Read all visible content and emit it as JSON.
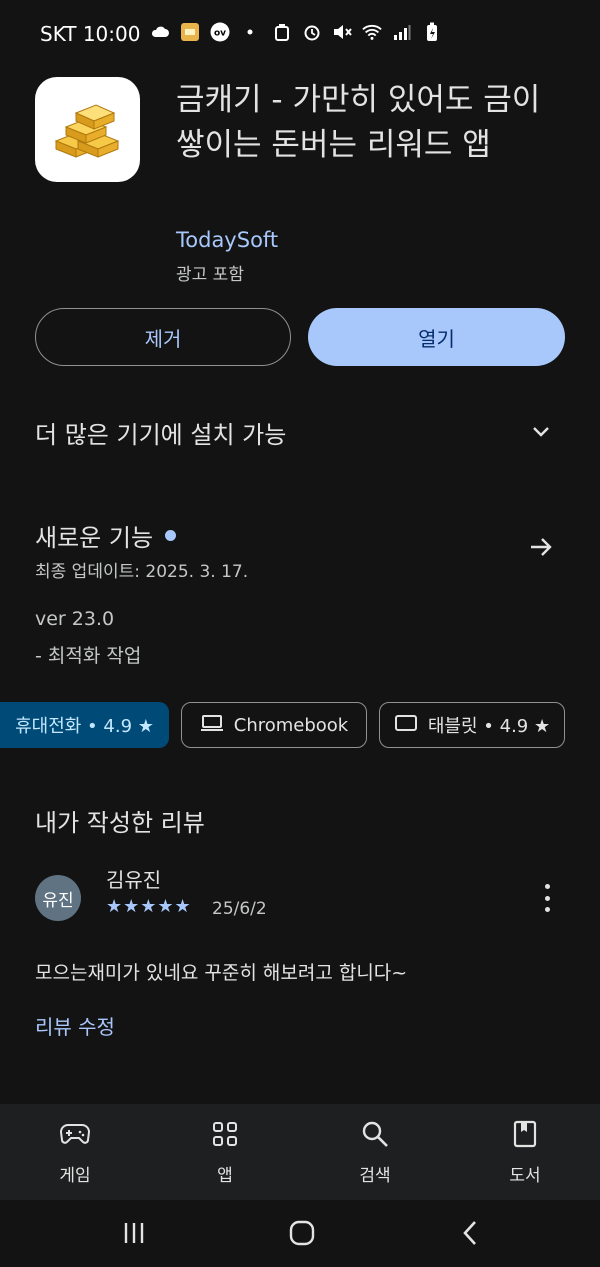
{
  "status_bar": {
    "carrier_time": "SKT 10:00",
    "icons": [
      "cloud-icon",
      "notification-app-icon",
      "ov-badge-icon",
      "dot-icon",
      "lock-battery-icon",
      "alarm-icon",
      "mute-icon",
      "wifi-icon",
      "signal-icon",
      "battery-charging-icon"
    ]
  },
  "app": {
    "title": "금캐기 - 가만히 있어도 금이 쌓이는 돈버는 리워드 앱",
    "developer": "TodaySoft",
    "ad_label": "광고 포함",
    "icon": "gold-bars-icon"
  },
  "buttons": {
    "remove": "제거",
    "open": "열기"
  },
  "more_devices": {
    "label": "더 많은 기기에 설치 가능"
  },
  "whats_new": {
    "title": "새로운 기능",
    "updated": "최종 업데이트: 2025. 3. 17.",
    "version": "ver 23.0",
    "note": "- 최적화 작업"
  },
  "device_chips": [
    {
      "label": "휴대전화 • 4.9 ★",
      "selected": true
    },
    {
      "label": "Chromebook",
      "icon": "laptop-icon"
    },
    {
      "label": "태블릿 • 4.9 ★",
      "icon": "tablet-icon"
    }
  ],
  "my_review": {
    "section_title": "내가 작성한 리뷰",
    "avatar_text": "유진",
    "reviewer": "김유진",
    "stars": "★★★★★",
    "rating": 5,
    "date": "25/6/2",
    "text": "모으는재미가 있네요 꾸준히 해보려고 합니다~",
    "edit_label": "리뷰 수정"
  },
  "bottom_nav": [
    {
      "label": "게임",
      "icon": "gamepad-icon"
    },
    {
      "label": "앱",
      "icon": "apps-grid-icon"
    },
    {
      "label": "검색",
      "icon": "search-icon"
    },
    {
      "label": "도서",
      "icon": "book-icon"
    }
  ],
  "colors": {
    "background": "#131314",
    "accent": "#a8c7fa",
    "open_button_text": "#062e6f",
    "chip_selected": "#004a77"
  }
}
